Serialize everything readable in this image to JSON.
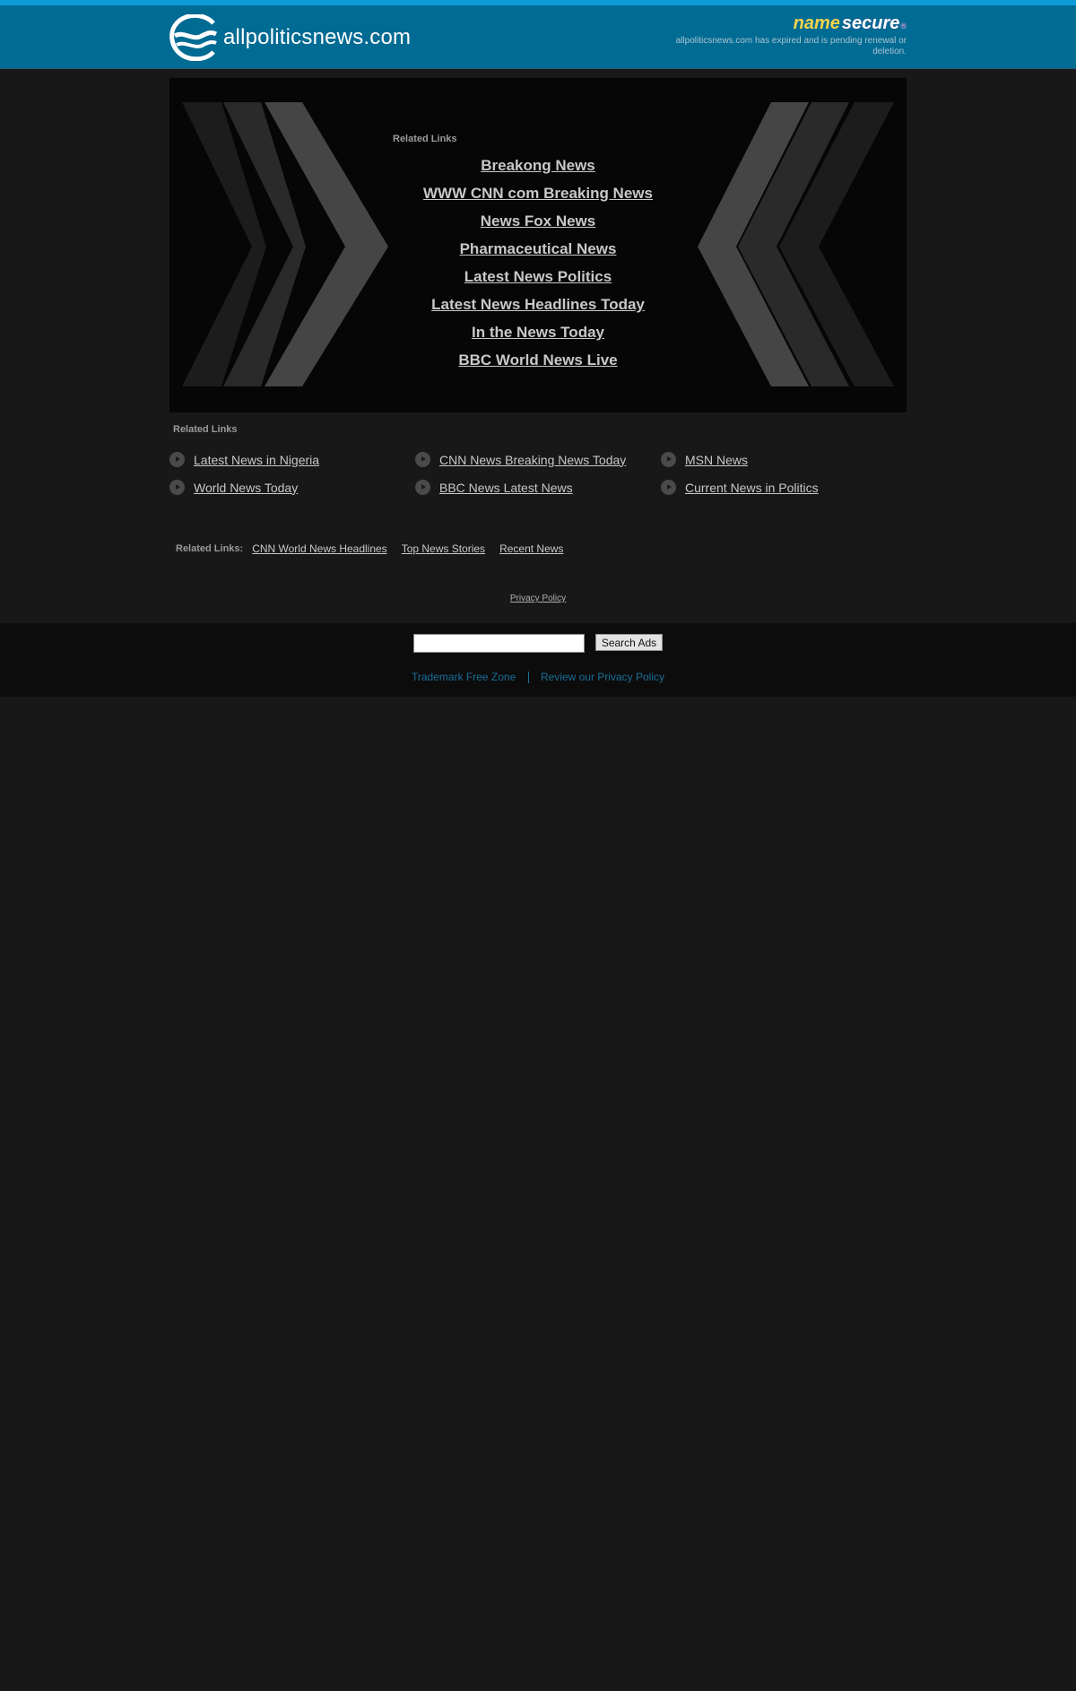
{
  "header": {
    "site_name": "allpoliticsnews.com",
    "brand_name": "name",
    "brand_secure": "secure",
    "brand_reg": "®",
    "notice": "allpoliticsnews.com has expired and is pending renewal or deletion."
  },
  "banner": {
    "heading": "Related Links",
    "links": [
      "Breakong News",
      "WWW CNN com Breaking News",
      "News Fox News",
      "Pharmaceutical News",
      "Latest News Politics",
      "Latest News Headlines Today",
      "In the News Today",
      "BBC World News Live"
    ]
  },
  "related": {
    "heading": "Related Links",
    "links": [
      "Latest News in Nigeria",
      "CNN News Breaking News Today",
      "MSN News",
      "World News Today",
      "BBC News Latest News",
      "Current News in Politics"
    ]
  },
  "inline_related": {
    "label": "Related Links:",
    "links": [
      "CNN World News Headlines",
      "Top News Stories",
      "Recent News"
    ]
  },
  "privacy_label": "Privacy Policy",
  "footer": {
    "search_value": "",
    "search_button": "Search Ads",
    "trademark_label": "Trademark Free Zone",
    "privacy_review_label": "Review our Privacy Policy"
  },
  "colors": {
    "background": "#181818",
    "header": "#006b93",
    "stripe": "#0f9bd8",
    "brand_yellow": "#f3d34a",
    "link_gray": "#c8c8c8",
    "footer_link": "#1a6f9a"
  }
}
